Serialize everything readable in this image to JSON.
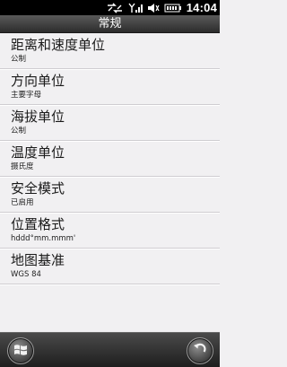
{
  "status_bar": {
    "time": "14:04",
    "icons": [
      "data-sync-icon",
      "signal-icon",
      "volume-icon",
      "battery-icon"
    ]
  },
  "header": {
    "title": "常规"
  },
  "settings": [
    {
      "label": "距离和速度单位",
      "value": "公制"
    },
    {
      "label": "方向单位",
      "value": "主要字母"
    },
    {
      "label": "海拔单位",
      "value": "公制"
    },
    {
      "label": "温度单位",
      "value": "摄氏度"
    },
    {
      "label": "安全模式",
      "value": "已启用"
    },
    {
      "label": "位置格式",
      "value": "hddd°mm.mmm'"
    },
    {
      "label": "地图基准",
      "value": "WGS 84"
    }
  ],
  "bottom_bar": {
    "left_icon": "windows-start-icon",
    "right_icon": "back-icon"
  }
}
